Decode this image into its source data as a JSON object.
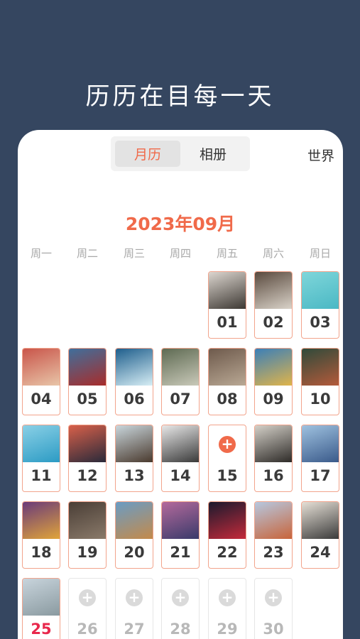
{
  "headline": "历历在目每一天",
  "tabs": {
    "month_label": "月历",
    "album_label": "相册"
  },
  "world_label": "世界",
  "month_title": "2023年09月",
  "weekdays": [
    "周一",
    "周二",
    "周三",
    "周四",
    "周五",
    "周六",
    "周日"
  ],
  "days": [
    {
      "n": "01",
      "kind": "photo",
      "colors": [
        "#dcd6cf",
        "#3d3833"
      ]
    },
    {
      "n": "02",
      "kind": "photo",
      "colors": [
        "#5a4a3e",
        "#d9d2c8"
      ]
    },
    {
      "n": "03",
      "kind": "photo",
      "colors": [
        "#7fd6da",
        "#4ab8c4"
      ]
    },
    {
      "n": "04",
      "kind": "photo",
      "colors": [
        "#c9554a",
        "#e8c5a8"
      ]
    },
    {
      "n": "05",
      "kind": "photo",
      "colors": [
        "#3f6f9c",
        "#a82c2a"
      ]
    },
    {
      "n": "06",
      "kind": "photo",
      "colors": [
        "#1e5e8c",
        "#d7eef5"
      ]
    },
    {
      "n": "07",
      "kind": "photo",
      "colors": [
        "#5e6a52",
        "#c9c9b9"
      ]
    },
    {
      "n": "08",
      "kind": "photo",
      "colors": [
        "#6e5a4c",
        "#b9a894"
      ]
    },
    {
      "n": "09",
      "kind": "photo",
      "colors": [
        "#3b7fb8",
        "#e0b44a"
      ]
    },
    {
      "n": "10",
      "kind": "photo",
      "colors": [
        "#2f4a3a",
        "#b45a3a"
      ]
    },
    {
      "n": "11",
      "kind": "photo",
      "colors": [
        "#8ad0e6",
        "#2c9bc4"
      ]
    },
    {
      "n": "12",
      "kind": "photo",
      "colors": [
        "#d8604a",
        "#2a2a3a"
      ]
    },
    {
      "n": "13",
      "kind": "photo",
      "colors": [
        "#c9d6dc",
        "#4a3a2e"
      ]
    },
    {
      "n": "14",
      "kind": "photo",
      "colors": [
        "#e8e8e8",
        "#3a3a3a"
      ]
    },
    {
      "n": "15",
      "kind": "add"
    },
    {
      "n": "16",
      "kind": "photo",
      "colors": [
        "#d4d0c8",
        "#2e2b28"
      ]
    },
    {
      "n": "17",
      "kind": "photo",
      "colors": [
        "#9fc2e0",
        "#3a5a8a"
      ]
    },
    {
      "n": "18",
      "kind": "photo",
      "colors": [
        "#6a3a7a",
        "#e0a43a"
      ]
    },
    {
      "n": "19",
      "kind": "photo",
      "colors": [
        "#4a3e36",
        "#8a7a6a"
      ]
    },
    {
      "n": "20",
      "kind": "photo",
      "colors": [
        "#6a9cc4",
        "#c48a4a"
      ]
    },
    {
      "n": "21",
      "kind": "photo",
      "colors": [
        "#b46a9c",
        "#3a3a6a"
      ]
    },
    {
      "n": "22",
      "kind": "photo",
      "colors": [
        "#1a1a2e",
        "#c42a3a"
      ]
    },
    {
      "n": "23",
      "kind": "photo",
      "colors": [
        "#b6c8e0",
        "#c8643a"
      ]
    },
    {
      "n": "24",
      "kind": "photo",
      "colors": [
        "#e6e0d6",
        "#3a3a3a"
      ]
    },
    {
      "n": "25",
      "kind": "photo",
      "today": true,
      "colors": [
        "#c8d4dc",
        "#8a9aa0"
      ]
    },
    {
      "n": "26",
      "kind": "future"
    },
    {
      "n": "27",
      "kind": "future"
    },
    {
      "n": "28",
      "kind": "future"
    },
    {
      "n": "29",
      "kind": "future"
    },
    {
      "n": "30",
      "kind": "future"
    }
  ],
  "colors": {
    "accent": "#f06a4a",
    "today": "#e8284c",
    "background": "#354660"
  }
}
